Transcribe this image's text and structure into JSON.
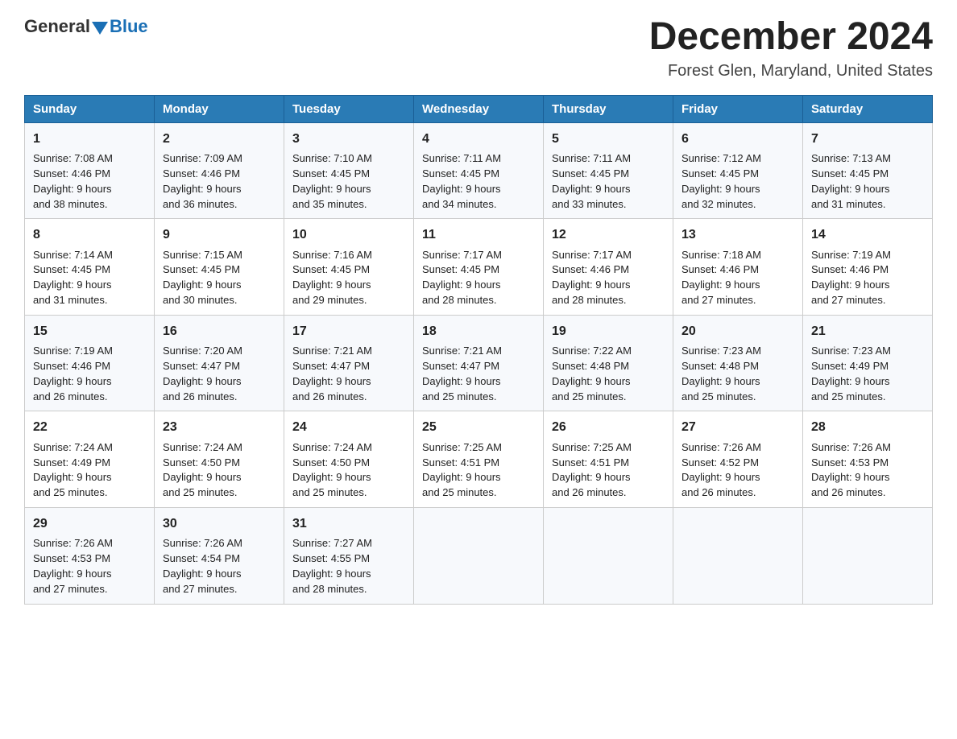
{
  "logo": {
    "general": "General",
    "blue": "Blue"
  },
  "title": "December 2024",
  "subtitle": "Forest Glen, Maryland, United States",
  "headers": [
    "Sunday",
    "Monday",
    "Tuesday",
    "Wednesday",
    "Thursday",
    "Friday",
    "Saturday"
  ],
  "weeks": [
    [
      {
        "day": "1",
        "sunrise": "7:08 AM",
        "sunset": "4:46 PM",
        "daylight": "9 hours and 38 minutes."
      },
      {
        "day": "2",
        "sunrise": "7:09 AM",
        "sunset": "4:46 PM",
        "daylight": "9 hours and 36 minutes."
      },
      {
        "day": "3",
        "sunrise": "7:10 AM",
        "sunset": "4:45 PM",
        "daylight": "9 hours and 35 minutes."
      },
      {
        "day": "4",
        "sunrise": "7:11 AM",
        "sunset": "4:45 PM",
        "daylight": "9 hours and 34 minutes."
      },
      {
        "day": "5",
        "sunrise": "7:11 AM",
        "sunset": "4:45 PM",
        "daylight": "9 hours and 33 minutes."
      },
      {
        "day": "6",
        "sunrise": "7:12 AM",
        "sunset": "4:45 PM",
        "daylight": "9 hours and 32 minutes."
      },
      {
        "day": "7",
        "sunrise": "7:13 AM",
        "sunset": "4:45 PM",
        "daylight": "9 hours and 31 minutes."
      }
    ],
    [
      {
        "day": "8",
        "sunrise": "7:14 AM",
        "sunset": "4:45 PM",
        "daylight": "9 hours and 31 minutes."
      },
      {
        "day": "9",
        "sunrise": "7:15 AM",
        "sunset": "4:45 PM",
        "daylight": "9 hours and 30 minutes."
      },
      {
        "day": "10",
        "sunrise": "7:16 AM",
        "sunset": "4:45 PM",
        "daylight": "9 hours and 29 minutes."
      },
      {
        "day": "11",
        "sunrise": "7:17 AM",
        "sunset": "4:45 PM",
        "daylight": "9 hours and 28 minutes."
      },
      {
        "day": "12",
        "sunrise": "7:17 AM",
        "sunset": "4:46 PM",
        "daylight": "9 hours and 28 minutes."
      },
      {
        "day": "13",
        "sunrise": "7:18 AM",
        "sunset": "4:46 PM",
        "daylight": "9 hours and 27 minutes."
      },
      {
        "day": "14",
        "sunrise": "7:19 AM",
        "sunset": "4:46 PM",
        "daylight": "9 hours and 27 minutes."
      }
    ],
    [
      {
        "day": "15",
        "sunrise": "7:19 AM",
        "sunset": "4:46 PM",
        "daylight": "9 hours and 26 minutes."
      },
      {
        "day": "16",
        "sunrise": "7:20 AM",
        "sunset": "4:47 PM",
        "daylight": "9 hours and 26 minutes."
      },
      {
        "day": "17",
        "sunrise": "7:21 AM",
        "sunset": "4:47 PM",
        "daylight": "9 hours and 26 minutes."
      },
      {
        "day": "18",
        "sunrise": "7:21 AM",
        "sunset": "4:47 PM",
        "daylight": "9 hours and 25 minutes."
      },
      {
        "day": "19",
        "sunrise": "7:22 AM",
        "sunset": "4:48 PM",
        "daylight": "9 hours and 25 minutes."
      },
      {
        "day": "20",
        "sunrise": "7:23 AM",
        "sunset": "4:48 PM",
        "daylight": "9 hours and 25 minutes."
      },
      {
        "day": "21",
        "sunrise": "7:23 AM",
        "sunset": "4:49 PM",
        "daylight": "9 hours and 25 minutes."
      }
    ],
    [
      {
        "day": "22",
        "sunrise": "7:24 AM",
        "sunset": "4:49 PM",
        "daylight": "9 hours and 25 minutes."
      },
      {
        "day": "23",
        "sunrise": "7:24 AM",
        "sunset": "4:50 PM",
        "daylight": "9 hours and 25 minutes."
      },
      {
        "day": "24",
        "sunrise": "7:24 AM",
        "sunset": "4:50 PM",
        "daylight": "9 hours and 25 minutes."
      },
      {
        "day": "25",
        "sunrise": "7:25 AM",
        "sunset": "4:51 PM",
        "daylight": "9 hours and 25 minutes."
      },
      {
        "day": "26",
        "sunrise": "7:25 AM",
        "sunset": "4:51 PM",
        "daylight": "9 hours and 26 minutes."
      },
      {
        "day": "27",
        "sunrise": "7:26 AM",
        "sunset": "4:52 PM",
        "daylight": "9 hours and 26 minutes."
      },
      {
        "day": "28",
        "sunrise": "7:26 AM",
        "sunset": "4:53 PM",
        "daylight": "9 hours and 26 minutes."
      }
    ],
    [
      {
        "day": "29",
        "sunrise": "7:26 AM",
        "sunset": "4:53 PM",
        "daylight": "9 hours and 27 minutes."
      },
      {
        "day": "30",
        "sunrise": "7:26 AM",
        "sunset": "4:54 PM",
        "daylight": "9 hours and 27 minutes."
      },
      {
        "day": "31",
        "sunrise": "7:27 AM",
        "sunset": "4:55 PM",
        "daylight": "9 hours and 28 minutes."
      },
      null,
      null,
      null,
      null
    ]
  ],
  "labels": {
    "sunrise": "Sunrise:",
    "sunset": "Sunset:",
    "daylight": "Daylight:"
  }
}
